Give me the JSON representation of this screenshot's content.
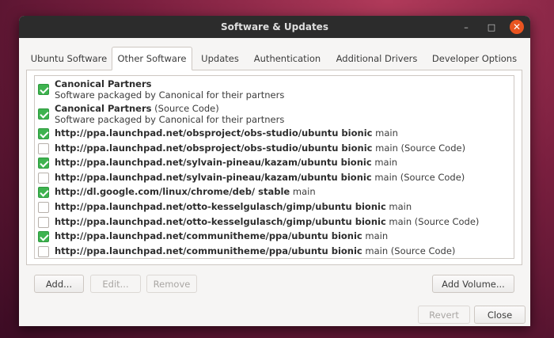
{
  "window": {
    "title": "Software & Updates"
  },
  "tabs": [
    {
      "label": "Ubuntu Software"
    },
    {
      "label": "Other Software"
    },
    {
      "label": "Updates"
    },
    {
      "label": "Authentication"
    },
    {
      "label": "Additional Drivers"
    },
    {
      "label": "Developer Options"
    }
  ],
  "sources": [
    {
      "name": "Canonical Partners",
      "suffix": "",
      "desc": "Software packaged by Canonical for their partners",
      "checked": true
    },
    {
      "name": "Canonical Partners",
      "suffix": "(Source Code)",
      "desc": "Software packaged by Canonical for their partners",
      "checked": true
    },
    {
      "name": "http://ppa.launchpad.net/obsproject/obs-studio/ubuntu bionic",
      "suffix": "main",
      "checked": true
    },
    {
      "name": "http://ppa.launchpad.net/obsproject/obs-studio/ubuntu bionic",
      "suffix": "main (Source Code)",
      "checked": false
    },
    {
      "name": "http://ppa.launchpad.net/sylvain-pineau/kazam/ubuntu bionic",
      "suffix": "main",
      "checked": true
    },
    {
      "name": "http://ppa.launchpad.net/sylvain-pineau/kazam/ubuntu bionic",
      "suffix": "main (Source Code)",
      "checked": false
    },
    {
      "name": "http://dl.google.com/linux/chrome/deb/ stable",
      "suffix": "main",
      "checked": true
    },
    {
      "name": "http://ppa.launchpad.net/otto-kesselgulasch/gimp/ubuntu bionic",
      "suffix": "main",
      "checked": false
    },
    {
      "name": "http://ppa.launchpad.net/otto-kesselgulasch/gimp/ubuntu bionic",
      "suffix": "main (Source Code)",
      "checked": false
    },
    {
      "name": "http://ppa.launchpad.net/communitheme/ppa/ubuntu bionic",
      "suffix": "main",
      "checked": true
    },
    {
      "name": "http://ppa.launchpad.net/communitheme/ppa/ubuntu bionic",
      "suffix": "main (Source Code)",
      "checked": false
    }
  ],
  "buttons": {
    "add": "Add...",
    "edit": "Edit...",
    "remove": "Remove",
    "add_volume": "Add Volume...",
    "revert": "Revert",
    "close": "Close"
  },
  "colors": {
    "check_on": "#3eb34f",
    "close_button": "#e95420",
    "titlebar": "#2c2c2c"
  }
}
